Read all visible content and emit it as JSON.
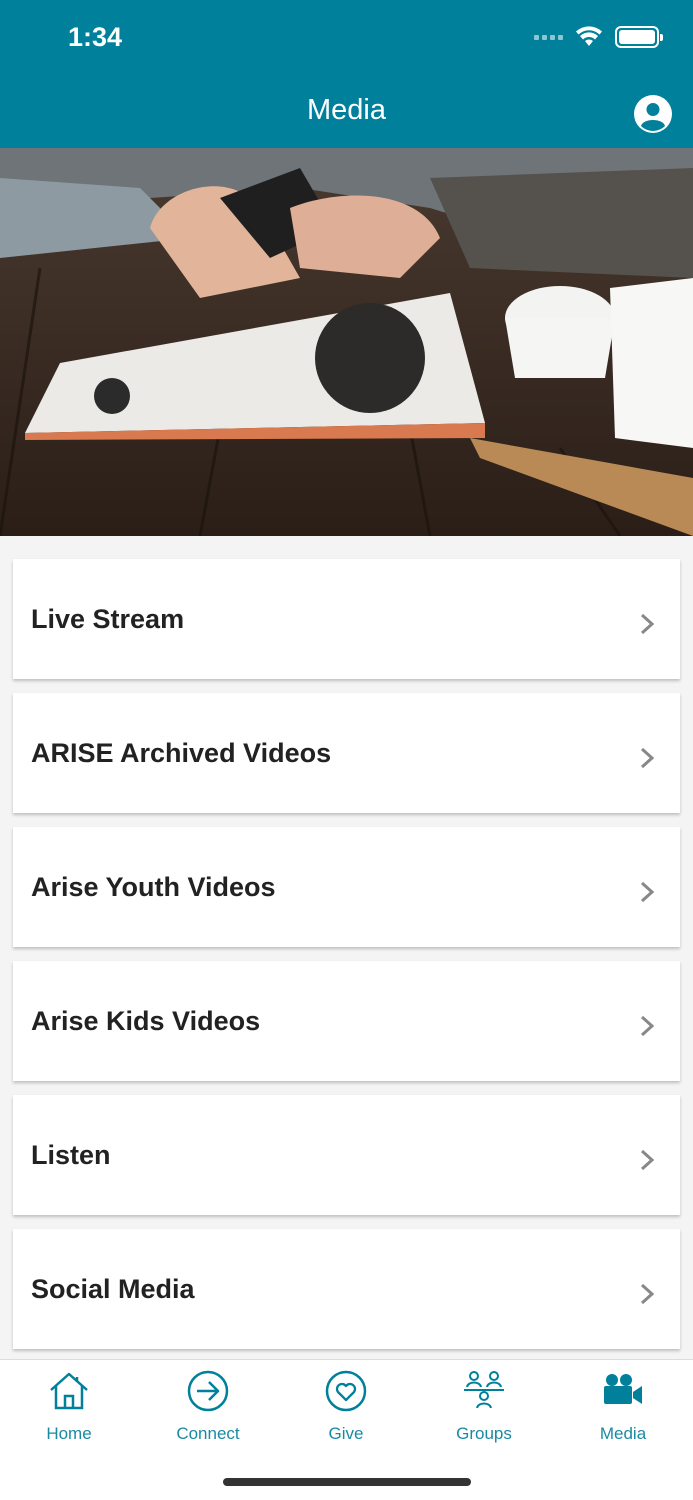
{
  "status_bar": {
    "time": "1:34"
  },
  "header": {
    "title": "Media",
    "profile_icon": "user-circle-icon"
  },
  "colors": {
    "brand": "#00809a",
    "text": "#222222",
    "background": "#f4f4f4"
  },
  "menu": {
    "items": [
      {
        "label": "Live Stream"
      },
      {
        "label": "ARISE Archived Videos"
      },
      {
        "label": "Arise Youth Videos"
      },
      {
        "label": "Arise Kids Videos"
      },
      {
        "label": "Listen"
      },
      {
        "label": "Social Media"
      }
    ]
  },
  "tabbar": {
    "tabs": [
      {
        "label": "Home",
        "icon": "home-icon"
      },
      {
        "label": "Connect",
        "icon": "arrow-circle-icon"
      },
      {
        "label": "Give",
        "icon": "heart-circle-icon"
      },
      {
        "label": "Groups",
        "icon": "people-icon"
      },
      {
        "label": "Media",
        "icon": "video-camera-icon",
        "active": true
      }
    ]
  }
}
